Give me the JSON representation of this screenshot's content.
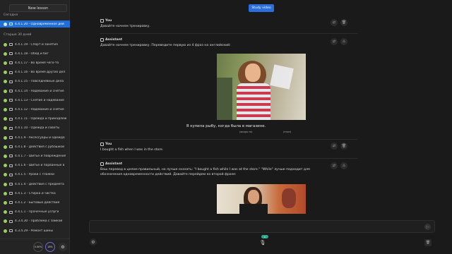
{
  "sidebar": {
    "new_lesson": "New lesson",
    "today_label": "Сегодня",
    "older_label": "Старше 30 дней",
    "today_items": [
      {
        "label": "4.4.1.20 - Одновременное дей"
      }
    ],
    "older_items": [
      {
        "label": "4.4.1.19 - Спорт и занятия"
      },
      {
        "label": "4.4.1.18 - Обед и бег"
      },
      {
        "label": "4.4.1.17 - Во время чего-то"
      },
      {
        "label": "4.4.1.16 - Во время других дел"
      },
      {
        "label": "4.4.1.15 - Повседневные дела"
      },
      {
        "label": "4.4.1.14 - Надевание и снятие"
      },
      {
        "label": "4.4.1.13 - Снятие и надевание"
      },
      {
        "label": "4.4.1.12 - Надевание и снятие"
      },
      {
        "label": "4.4.1.11 - Одежда и принадлеж"
      },
      {
        "label": "4.4.1.10 - Одежда и советы"
      },
      {
        "label": "4.4.1.9 - Аксессуары и одежда"
      },
      {
        "label": "4.4.1.8 - Действия с рубашкой"
      },
      {
        "label": "4.4.1.7 - Шитье и повреждения"
      },
      {
        "label": "4.4.1.6 - Шитье и порванные в"
      },
      {
        "label": "4.4.1.5 - Уроки с глажки"
      },
      {
        "label": "4.4.1.4 - Действия с предмета"
      },
      {
        "label": "4.4.1.3 - Стирка и чистка"
      },
      {
        "label": "4.4.1.2 - Бытовые действия"
      },
      {
        "label": "4.4.1.1 - Прачечные услуги"
      },
      {
        "label": "4.3.4.30 - Проблема с замкой"
      },
      {
        "label": "4.3.4.29 - Ремонт шины"
      }
    ],
    "stat_left": "0.00%",
    "stat_right": "18%"
  },
  "header": {
    "study_video": "Study video"
  },
  "messages": {
    "m1": {
      "author": "You",
      "text": "Давайте начнем тренировку."
    },
    "m2": {
      "author": "Assistant",
      "text": "Давайте начнем тренировку. Переведите первую из 4 фраз на английский:",
      "sentence": "Я купила рыбу, когда была в магазине.",
      "gloss_left": "(акира-то)",
      "gloss_right": "(этом)"
    },
    "m3": {
      "author": "You",
      "text": "I bought a fish when I was in the store."
    },
    "m4": {
      "author": "Assistant",
      "text": "Ваш перевод в целом правильный, но лучше сказать: \"I bought a fish while I was at the store.\" \"While\" лучше подходит для обозначения одновременности действий. Давайте перейдем ко второй фразе:"
    }
  },
  "input": {
    "placeholder": ""
  },
  "mic_badge": "0"
}
